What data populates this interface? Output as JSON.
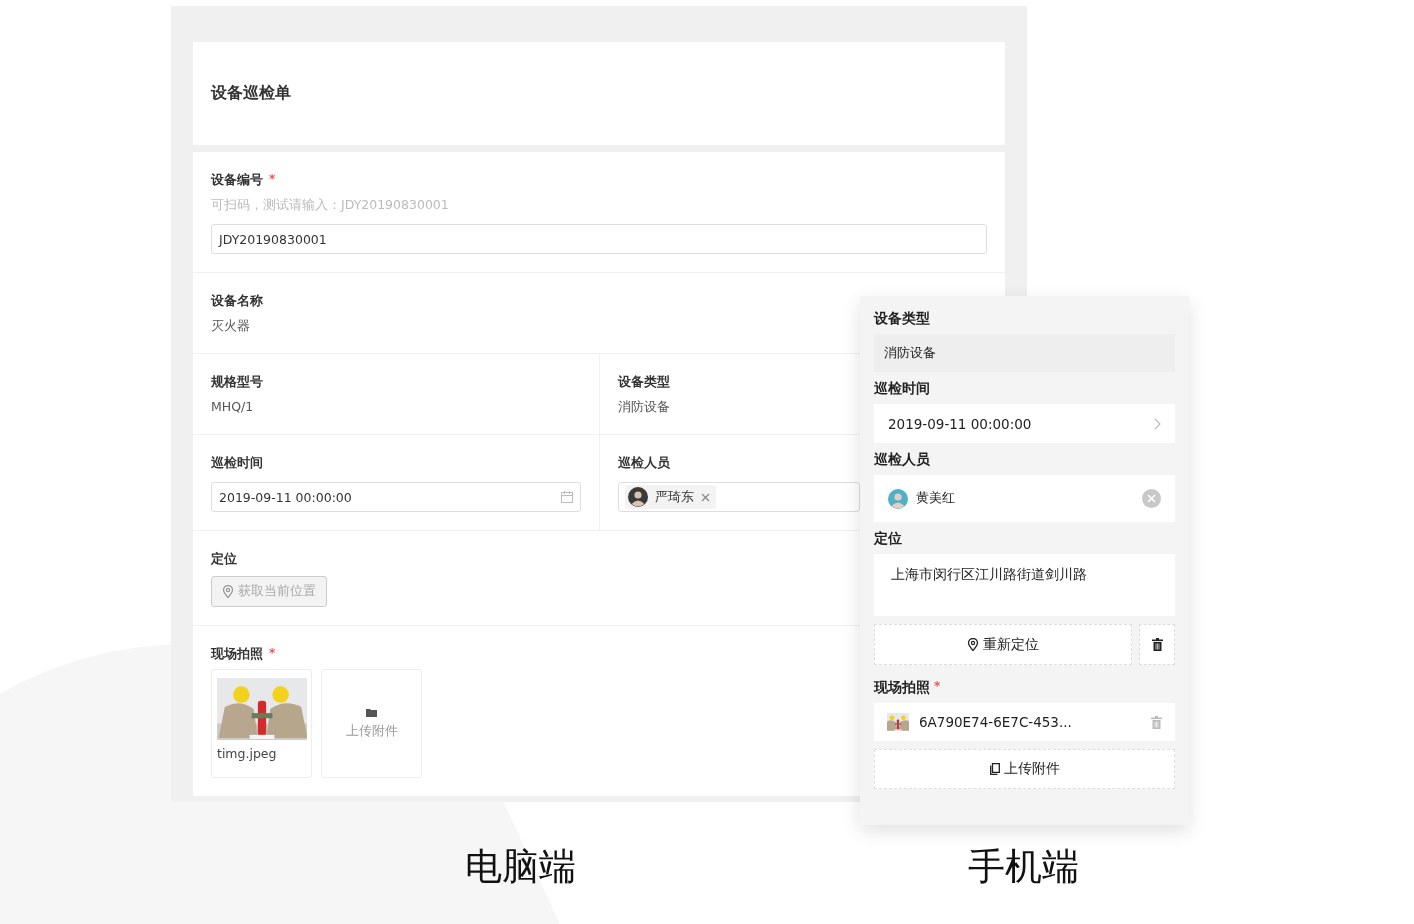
{
  "desktop": {
    "caption": "电脑端",
    "title": "设备巡检单",
    "fields": [
      {
        "kind": "input",
        "label": "设备编号",
        "required_mark": "*",
        "hint": "可扫码，测试请输入：JDY20190830001",
        "value": "JDY20190830001"
      },
      {
        "kind": "text",
        "label": "设备名称",
        "value": "灭火器"
      },
      {
        "kind": "pair",
        "columns": [
          {
            "kind": "text",
            "label": "规格型号",
            "value": "MHQ/1"
          },
          {
            "kind": "text",
            "label": "设备类型",
            "value": "消防设备"
          }
        ]
      },
      {
        "kind": "pair",
        "columns": [
          {
            "kind": "date",
            "label": "巡检时间",
            "value": "2019-09-11 00:00:00"
          },
          {
            "kind": "member",
            "label": "巡检人员",
            "value": "严琦东"
          }
        ]
      },
      {
        "kind": "location",
        "label": "定位",
        "button": "获取当前位置"
      },
      {
        "kind": "upload",
        "label": "现场拍照",
        "required_mark": "*",
        "files": [
          "timg.jpeg"
        ],
        "button": "上传附件"
      }
    ]
  },
  "mobile": {
    "caption": "手机端",
    "fields": [
      {
        "kind": "readonly",
        "label": "设备类型",
        "value": "消防设备"
      },
      {
        "kind": "picker",
        "label": "巡检时间",
        "value": "2019-09-11 00:00:00"
      },
      {
        "kind": "member",
        "label": "巡检人员",
        "value": "黄美红"
      },
      {
        "kind": "location",
        "label": "定位",
        "value": "上海市闵行区江川路街道剑川路",
        "button": "重新定位"
      },
      {
        "kind": "upload",
        "label": "现场拍照",
        "required_mark": "*",
        "files": [
          "6A790E74-6E7C-453..."
        ],
        "button": "上传附件"
      }
    ]
  }
}
